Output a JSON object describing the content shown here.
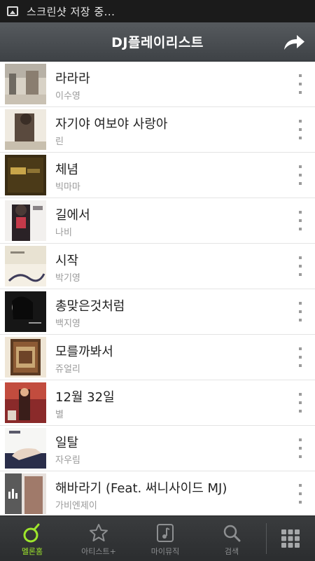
{
  "status_bar": {
    "text": "스크린샷 저장 중..."
  },
  "header": {
    "title": "DJ플레이리스트"
  },
  "songs": [
    {
      "title": "라라라",
      "artist": "이수영"
    },
    {
      "title": "자기야 여보야 사랑아",
      "artist": "린"
    },
    {
      "title": "체념",
      "artist": "빅마마"
    },
    {
      "title": "길에서",
      "artist": "나비"
    },
    {
      "title": "시작",
      "artist": "박기영"
    },
    {
      "title": "총맞은것처럼",
      "artist": "백지영"
    },
    {
      "title": "모를까봐서",
      "artist": "쥬얼리"
    },
    {
      "title": "12월 32일",
      "artist": "별"
    },
    {
      "title": "일탈",
      "artist": "자우림"
    },
    {
      "title": "해바라기 (Feat. 써니사이드 MJ)",
      "artist": "가비엔제이"
    }
  ],
  "tabs": [
    {
      "label": "멜론홈",
      "icon": "melon-home-icon",
      "active": true
    },
    {
      "label": "아티스트+",
      "icon": "star-icon",
      "active": false
    },
    {
      "label": "마이뮤직",
      "icon": "music-note-icon",
      "active": false
    },
    {
      "label": "검색",
      "icon": "search-icon",
      "active": false
    }
  ],
  "colors": {
    "active_tab": "#9ee62c",
    "header": "#4a4e52",
    "status_bar": "#1b1b1b"
  }
}
